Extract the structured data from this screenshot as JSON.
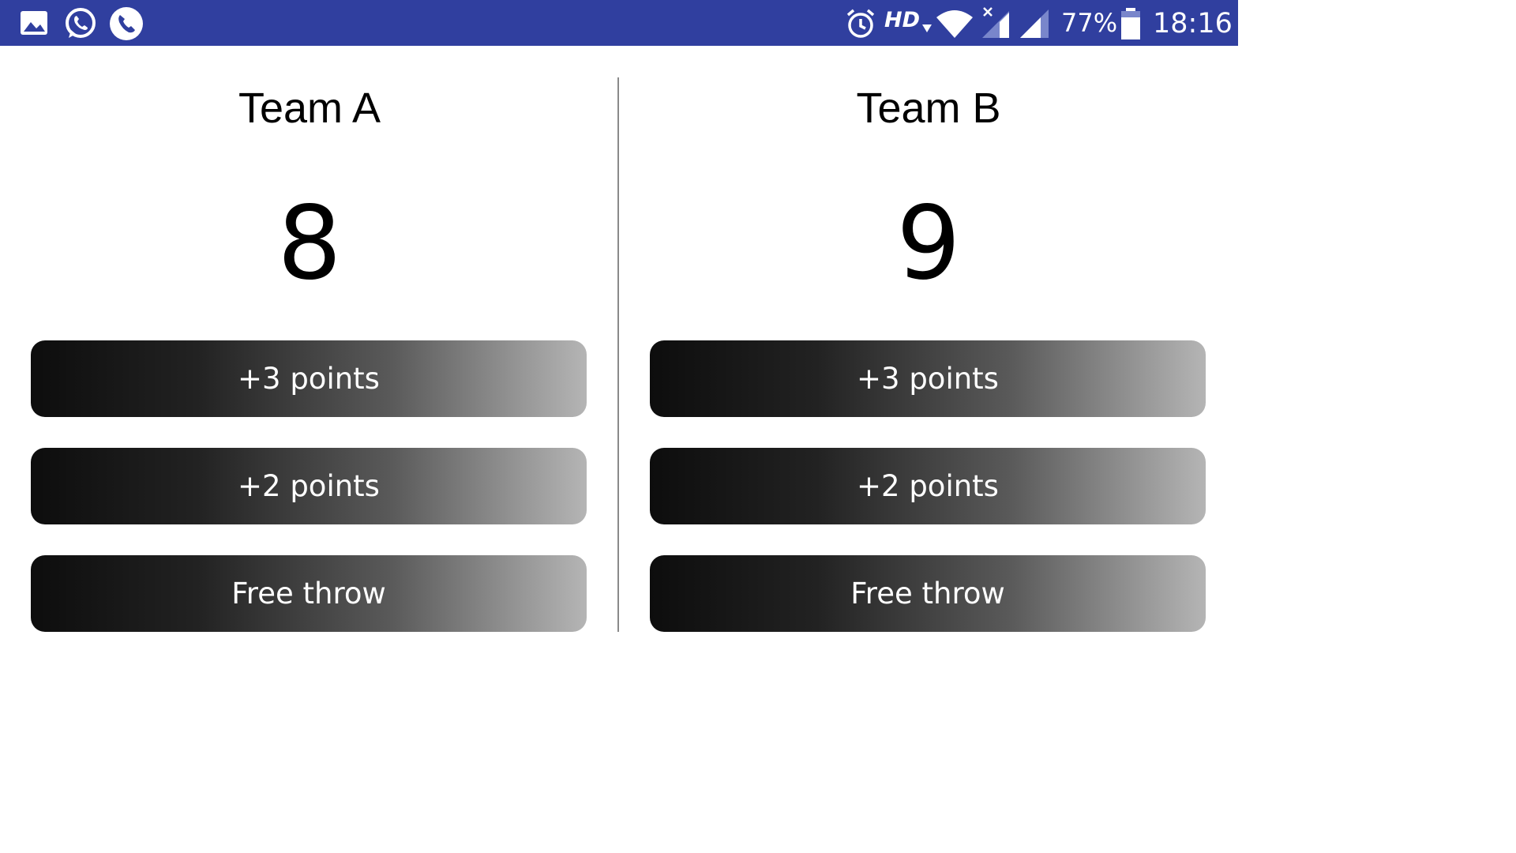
{
  "status_bar": {
    "notification_icons": [
      "image-icon",
      "whatsapp-icon",
      "phone-call-icon"
    ],
    "system_icons": [
      "alarm-icon",
      "wifi-icon",
      "signal-no-service-icon",
      "signal-icon",
      "battery-icon"
    ],
    "hd_label": "HD",
    "battery_percent": "77%",
    "time": "18:16",
    "background_color": "#303f9f"
  },
  "team_a": {
    "name": "Team A",
    "score": "8",
    "buttons": {
      "three_points": "+3 points",
      "two_points": "+2 points",
      "free_throw": "Free throw"
    }
  },
  "team_b": {
    "name": "Team B",
    "score": "9",
    "buttons": {
      "three_points": "+3 points",
      "two_points": "+2 points",
      "free_throw": "Free throw"
    }
  }
}
